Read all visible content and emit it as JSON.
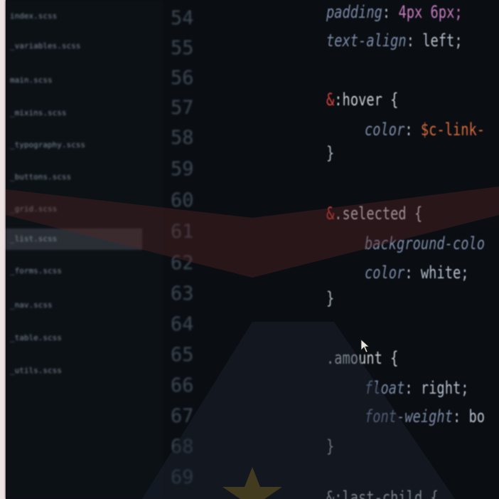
{
  "colors": {
    "background": "#0a0e13",
    "sidebar": "#0c1116",
    "line_number": "#3e4852",
    "property": "#7c8aa6",
    "ampersand": "#d8413b",
    "variable": "#d86a3b",
    "number": "#c77dbd",
    "overlay_band": "#4a2424",
    "overlay_star": "#6b5a1f"
  },
  "sidebar": {
    "items": [
      {
        "label": "index.scss"
      },
      {
        "label": "_variables.scss"
      },
      {
        "label": "main.scss"
      },
      {
        "label": "_mixins.scss"
      },
      {
        "label": "_typography.scss"
      },
      {
        "label": "_buttons.scss"
      },
      {
        "label": "_grid.scss"
      },
      {
        "label": "_list.scss"
      },
      {
        "label": "_forms.scss"
      },
      {
        "label": "_nav.scss"
      },
      {
        "label": "_table.scss"
      },
      {
        "label": "_utils.scss"
      }
    ]
  },
  "gutter": {
    "line_numbers": [
      "54",
      "55",
      "56",
      "57",
      "58",
      "59",
      "60",
      "61",
      "62",
      "63",
      "64",
      "65",
      "66",
      "67",
      "68",
      "69"
    ]
  },
  "code": {
    "l54_prop": "padding",
    "l54_rest": ": ",
    "l54_val": "4px 6px;",
    "l55_prop": "text-align",
    "l55_rest": ": left;",
    "l57_amp": "&",
    "l57_sel": ":hover {",
    "l58_prop": "color",
    "l58_rest": ": ",
    "l58_var": "$c-link-",
    "l59_brace": "}",
    "l61_amp": "&",
    "l61_sel": ".selected {",
    "l62_prop": "background-colo",
    "l63_prop": "color",
    "l63_rest": ": white;",
    "l64_brace": "}",
    "l66_sel": ".amount {",
    "l67_prop": "float",
    "l67_rest": ": right;",
    "l68_prop": "font-weight",
    "l68_rest": ": bo",
    "l69_brace": "}",
    "l70_sel": "&:last-child {"
  }
}
